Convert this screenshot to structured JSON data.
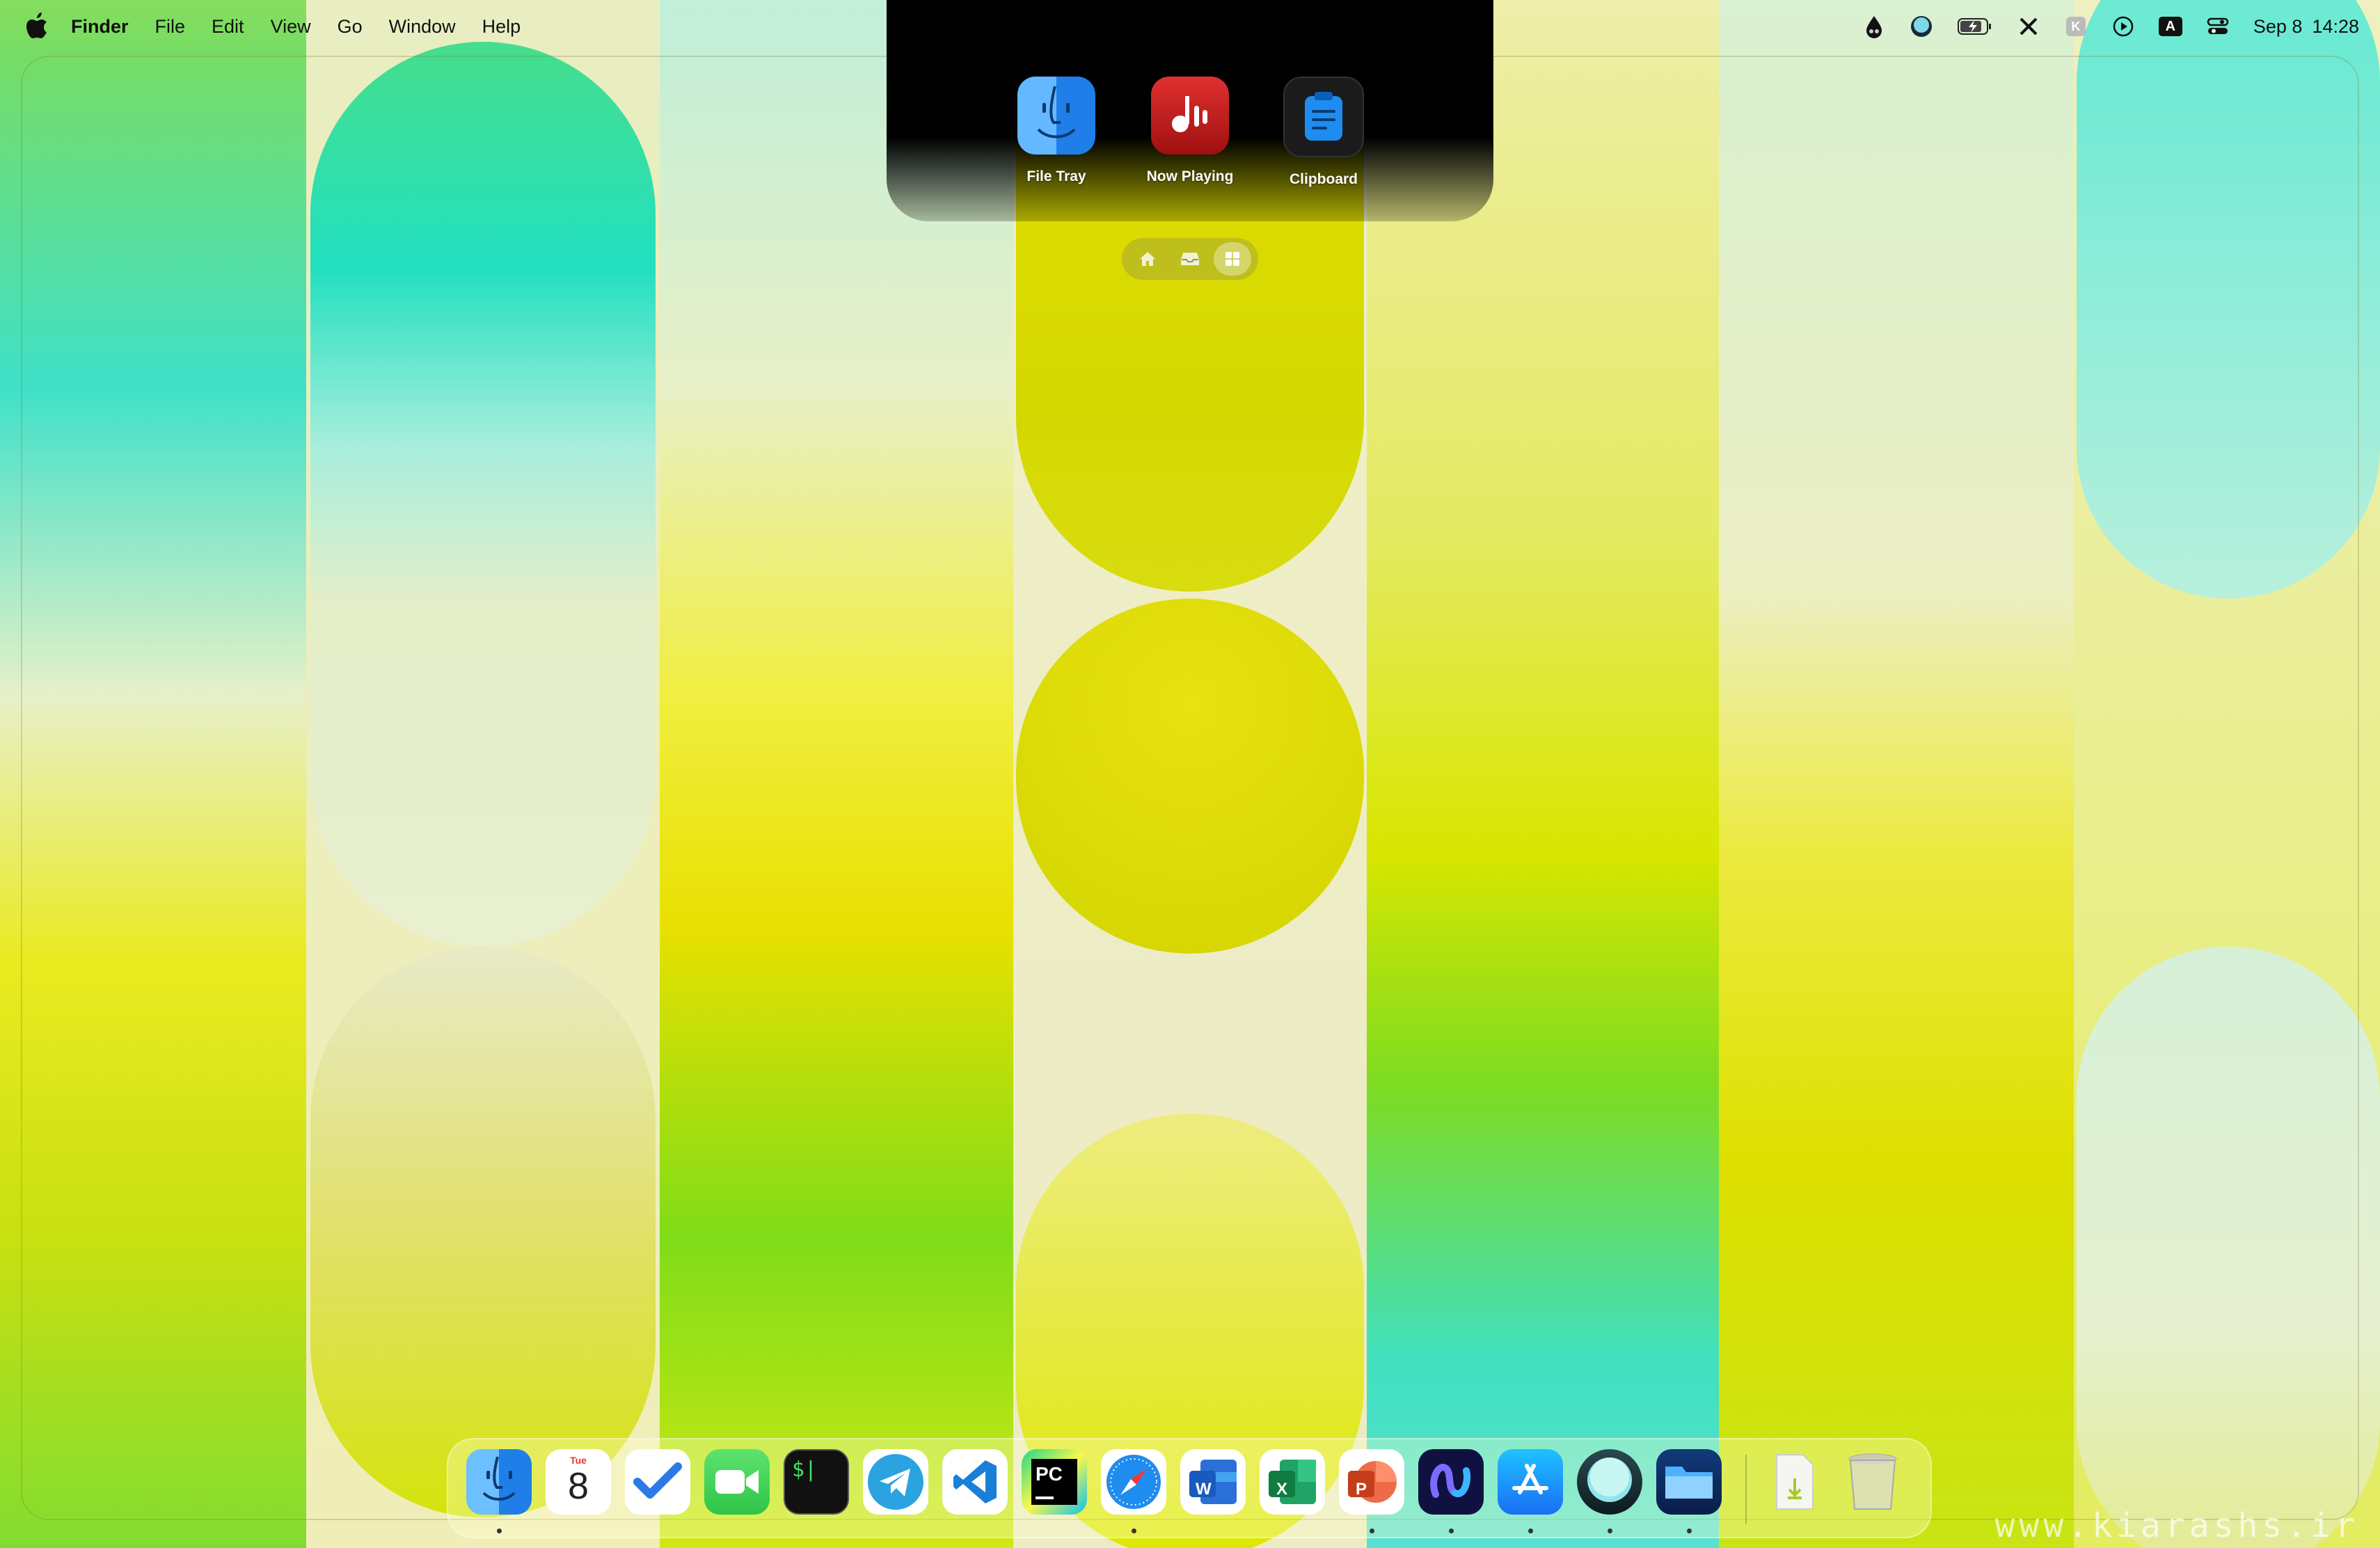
{
  "menubar": {
    "app_name": "Finder",
    "menus": [
      "File",
      "Edit",
      "View",
      "Go",
      "Window",
      "Help"
    ],
    "status_icons": [
      "droplet-icon",
      "moon-circle-icon",
      "battery-charging-icon",
      "x-app-icon",
      "k-app-icon",
      "play-circle-icon",
      "input-source-icon",
      "control-center-icon"
    ],
    "input_source_label": "A",
    "k_app_label": "K",
    "date": "Sep 8",
    "time": "14:28"
  },
  "notch_panel": {
    "apps": [
      {
        "label": "File Tray",
        "icon": "finder-face-icon",
        "color": "#2f8ff0"
      },
      {
        "label": "Now Playing",
        "icon": "music-waveform-icon",
        "color": "#c11a1a"
      },
      {
        "label": "Clipboard",
        "icon": "clipboard-icon",
        "color": "#1a1a1a"
      }
    ],
    "tabs": [
      {
        "name": "home",
        "icon": "home-icon",
        "active": false
      },
      {
        "name": "tray",
        "icon": "tray-icon",
        "active": false
      },
      {
        "name": "grid",
        "icon": "grid-icon",
        "active": true
      }
    ]
  },
  "dock": {
    "apps": [
      {
        "name": "Finder",
        "icon": "finder-icon",
        "running": true
      },
      {
        "name": "Calendar",
        "icon": "calendar-icon",
        "running": false,
        "month": "Tue",
        "day": "8"
      },
      {
        "name": "Tasks",
        "icon": "checkmark-icon",
        "running": false
      },
      {
        "name": "FaceTime",
        "icon": "video-camera-icon",
        "running": false
      },
      {
        "name": "Terminal",
        "icon": "terminal-icon",
        "running": false,
        "glyph": "$|"
      },
      {
        "name": "Telegram",
        "icon": "paper-plane-icon",
        "running": false
      },
      {
        "name": "Visual Studio Code",
        "icon": "vscode-icon",
        "running": false
      },
      {
        "name": "PyCharm",
        "icon": "pycharm-icon",
        "running": false,
        "glyph": "PC"
      },
      {
        "name": "Safari",
        "icon": "compass-icon",
        "running": true
      },
      {
        "name": "Word",
        "icon": "word-icon",
        "running": false,
        "glyph": "W"
      },
      {
        "name": "Excel",
        "icon": "excel-icon",
        "running": false,
        "glyph": "X"
      },
      {
        "name": "PowerPoint",
        "icon": "powerpoint-icon",
        "running": true,
        "glyph": "P"
      },
      {
        "name": "Loop",
        "icon": "loop-icon",
        "running": true
      },
      {
        "name": "App Store",
        "icon": "app-store-icon",
        "running": true
      },
      {
        "name": "Moon App",
        "icon": "moon-app-icon",
        "running": true
      },
      {
        "name": "Files",
        "icon": "folder-icon",
        "running": true
      },
      {
        "name": "Downloads",
        "icon": "downloads-stack-icon",
        "running": false
      },
      {
        "name": "Trash",
        "icon": "trash-icon",
        "running": false
      }
    ]
  },
  "watermark": "www.kiarashs.ir"
}
